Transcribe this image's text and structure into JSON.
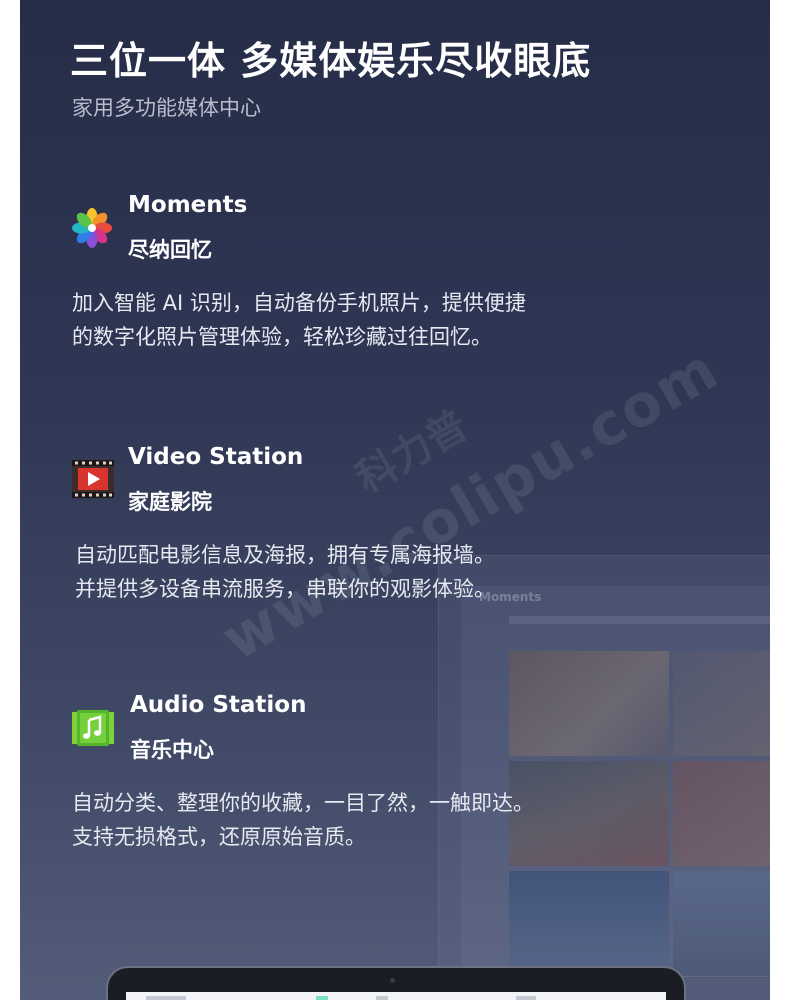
{
  "header": {
    "title": "三位一体 多媒体娱乐尽收眼底",
    "subtitle": "家用多功能媒体中心"
  },
  "features": [
    {
      "icon": "moments-pinwheel-icon",
      "name": "Moments",
      "subtitle": "尽纳回忆",
      "description_lines": [
        "加入智能 AI 识别，自动备份手机照片，提供便捷",
        "的数字化照片管理体验，轻松珍藏过往回忆。"
      ]
    },
    {
      "icon": "video-station-film-icon",
      "name": "Video Station",
      "subtitle": "家庭影院",
      "description_lines": [
        "自动匹配电影信息及海报，拥有专属海报墙。",
        "并提供多设备串流服务，串联你的观影体验。"
      ]
    },
    {
      "icon": "audio-station-music-icon",
      "name": "Audio Station",
      "subtitle": "音乐中心",
      "description_lines": [
        "自动分类、整理你的收藏，一目了然，一触即达。",
        "支持无损格式，还原原始音质。"
      ]
    }
  ],
  "background_app": {
    "title": "Moments"
  },
  "watermark": {
    "brand": "科力普",
    "url": "www.colipu.com"
  },
  "colors": {
    "panel_top": "#262d47",
    "panel_bottom": "#535c78",
    "text_primary": "#ffffff",
    "text_secondary": "#b9bdcc"
  }
}
